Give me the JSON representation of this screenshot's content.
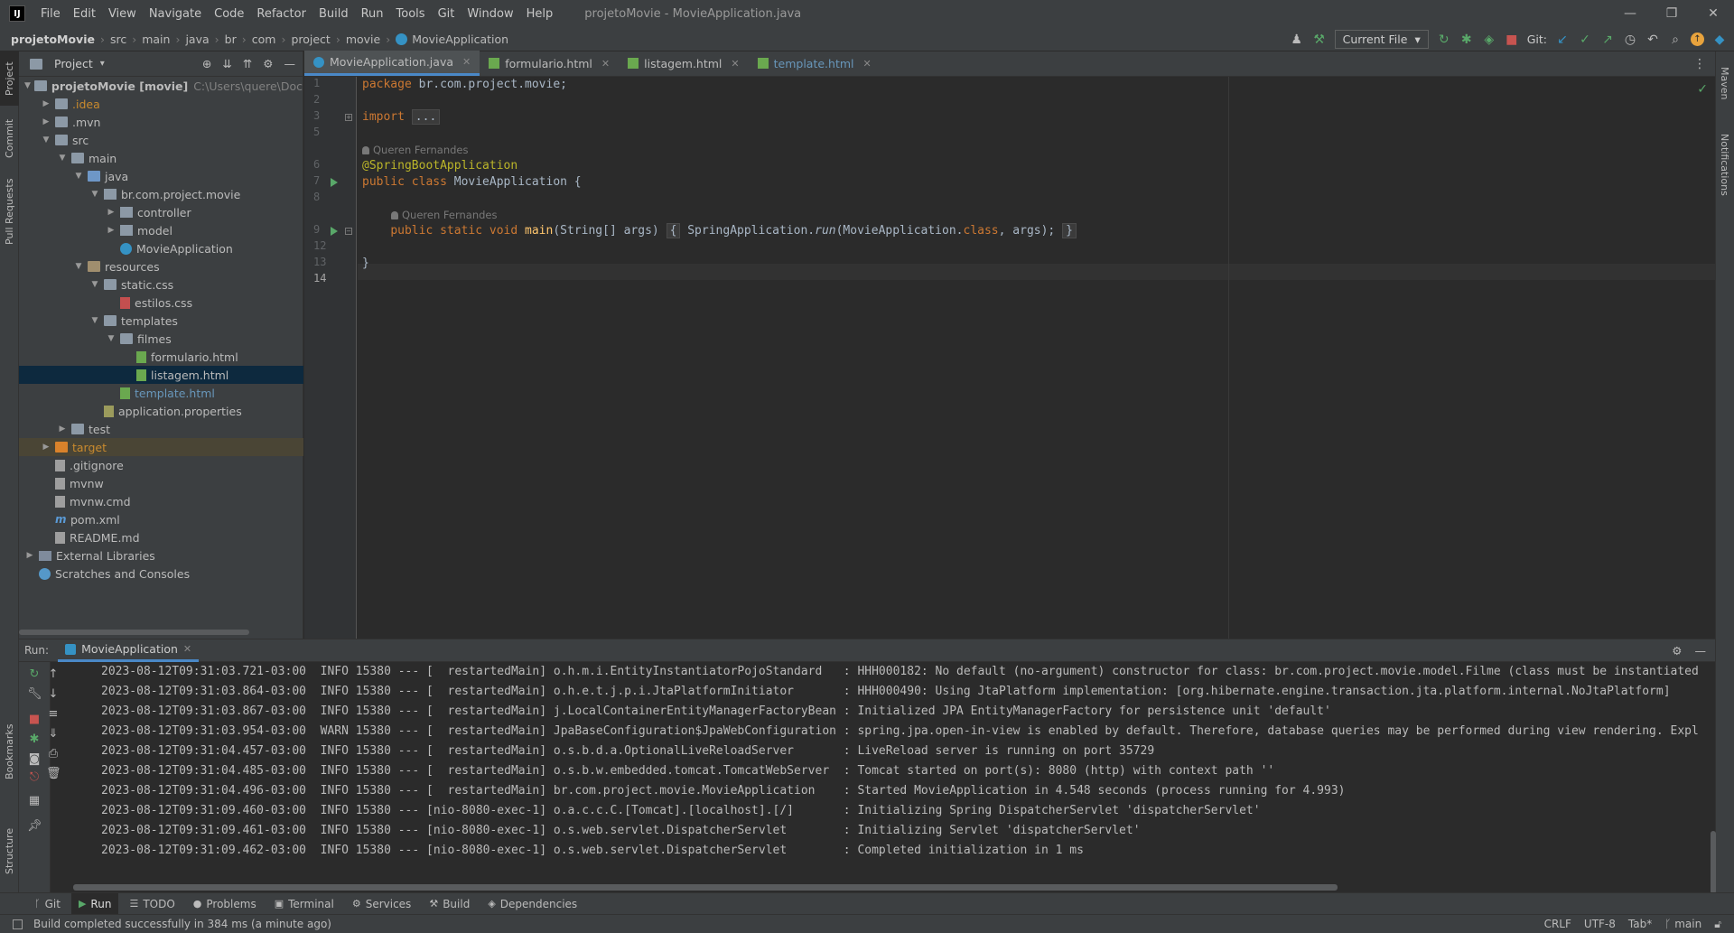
{
  "app": {
    "logo": "IJ",
    "menu": [
      "File",
      "Edit",
      "View",
      "Navigate",
      "Code",
      "Refactor",
      "Build",
      "Run",
      "Tools",
      "Git",
      "Window",
      "Help"
    ],
    "window_title": "projetoMovie - MovieApplication.java",
    "window_controls": {
      "minimize": "—",
      "restore": "❐",
      "close": "✕"
    }
  },
  "navbar": {
    "breadcrumb": [
      "projetoMovie",
      "src",
      "main",
      "java",
      "br",
      "com",
      "project",
      "movie",
      "MovieApplication"
    ],
    "run_config": "Current File",
    "git_label": "Git:"
  },
  "left_strip": {
    "tabs": [
      "Project",
      "Commit",
      "Pull Requests",
      "Bookmarks",
      "Structure"
    ]
  },
  "right_strip": {
    "tabs": [
      "Maven",
      "Notifications"
    ]
  },
  "project_panel": {
    "title": "Project",
    "root_path": "C:\\Users\\quere\\Documents\\",
    "tree": [
      {
        "label": "projetoMovie [movie]",
        "depth": 0,
        "arrow": "open",
        "icon": "folder"
      },
      {
        "label": ".idea",
        "depth": 1,
        "arrow": "closed",
        "icon": "folder",
        "color": "orange"
      },
      {
        "label": ".mvn",
        "depth": 1,
        "arrow": "closed",
        "icon": "folder"
      },
      {
        "label": "src",
        "depth": 1,
        "arrow": "open",
        "icon": "folder"
      },
      {
        "label": "main",
        "depth": 2,
        "arrow": "open",
        "icon": "folder"
      },
      {
        "label": "java",
        "depth": 3,
        "arrow": "open",
        "icon": "folder-blue"
      },
      {
        "label": "br.com.project.movie",
        "depth": 4,
        "arrow": "open",
        "icon": "package"
      },
      {
        "label": "controller",
        "depth": 5,
        "arrow": "closed",
        "icon": "package"
      },
      {
        "label": "model",
        "depth": 5,
        "arrow": "closed",
        "icon": "package"
      },
      {
        "label": "MovieApplication",
        "depth": 5,
        "arrow": "none",
        "icon": "java"
      },
      {
        "label": "resources",
        "depth": 3,
        "arrow": "open",
        "icon": "folder-res"
      },
      {
        "label": "static.css",
        "depth": 4,
        "arrow": "open",
        "icon": "folder"
      },
      {
        "label": "estilos.css",
        "depth": 5,
        "arrow": "none",
        "icon": "css"
      },
      {
        "label": "templates",
        "depth": 4,
        "arrow": "open",
        "icon": "folder"
      },
      {
        "label": "filmes",
        "depth": 5,
        "arrow": "open",
        "icon": "folder"
      },
      {
        "label": "formulario.html",
        "depth": 6,
        "arrow": "none",
        "icon": "html"
      },
      {
        "label": "listagem.html",
        "depth": 6,
        "arrow": "none",
        "icon": "html",
        "selected": true
      },
      {
        "label": "template.html",
        "depth": 5,
        "arrow": "none",
        "icon": "html",
        "color": "blue"
      },
      {
        "label": "application.properties",
        "depth": 4,
        "arrow": "none",
        "icon": "props"
      },
      {
        "label": "test",
        "depth": 2,
        "arrow": "closed",
        "icon": "folder"
      },
      {
        "label": "target",
        "depth": 1,
        "arrow": "closed",
        "icon": "folder-orange",
        "color": "orange",
        "excluded": true
      },
      {
        "label": ".gitignore",
        "depth": 1,
        "arrow": "none",
        "icon": "file"
      },
      {
        "label": "mvnw",
        "depth": 1,
        "arrow": "none",
        "icon": "file"
      },
      {
        "label": "mvnw.cmd",
        "depth": 1,
        "arrow": "none",
        "icon": "file"
      },
      {
        "label": "pom.xml",
        "depth": 1,
        "arrow": "none",
        "icon": "maven"
      },
      {
        "label": "README.md",
        "depth": 1,
        "arrow": "none",
        "icon": "file"
      },
      {
        "label": "External Libraries",
        "depth": 0,
        "arrow": "closed",
        "icon": "libs"
      },
      {
        "label": "Scratches and Consoles",
        "depth": 0,
        "arrow": "none",
        "icon": "scratch"
      }
    ]
  },
  "editor": {
    "tabs": [
      {
        "label": "MovieApplication.java",
        "icon": "java",
        "active": true
      },
      {
        "label": "formulario.html",
        "icon": "html"
      },
      {
        "label": "listagem.html",
        "icon": "html"
      },
      {
        "label": "template.html",
        "icon": "html",
        "color": "blue"
      }
    ],
    "line_numbers": [
      "1",
      "2",
      "3",
      "5",
      "6",
      "7",
      "8",
      "9",
      "12",
      "13",
      "14"
    ],
    "author": "Queren Fernandes",
    "code": {
      "l1_kw": "package",
      "l1_rest": " br.com.project.movie;",
      "l3_kw": "import",
      "l3_fold": "...",
      "l6_ann": "@SpringBootApplication",
      "l7_kw": "public class",
      "l7_rest": " MovieApplication {",
      "l9_kw": "public static void",
      "l9_fn": "main",
      "l9_params": "(String[] args)",
      "l9_open": "{",
      "l9_body_a": "SpringApplication.",
      "l9_body_run": "run",
      "l9_body_b": "(MovieApplication.",
      "l9_body_class": "class",
      "l9_body_c": ", args);",
      "l9_close": "}",
      "l13": "}"
    }
  },
  "run_panel": {
    "label": "Run:",
    "tab": "MovieApplication",
    "console": [
      "2023-08-12T09:31:03.721-03:00  INFO 15380 --- [  restartedMain] o.h.m.i.EntityInstantiatorPojoStandard   : HHH000182: No default (no-argument) constructor for class: br.com.project.movie.model.Filme (class must be instantiated",
      "2023-08-12T09:31:03.864-03:00  INFO 15380 --- [  restartedMain] o.h.e.t.j.p.i.JtaPlatformInitiator       : HHH000490: Using JtaPlatform implementation: [org.hibernate.engine.transaction.jta.platform.internal.NoJtaPlatform]",
      "2023-08-12T09:31:03.867-03:00  INFO 15380 --- [  restartedMain] j.LocalContainerEntityManagerFactoryBean : Initialized JPA EntityManagerFactory for persistence unit 'default'",
      "2023-08-12T09:31:03.954-03:00  WARN 15380 --- [  restartedMain] JpaBaseConfiguration$JpaWebConfiguration : spring.jpa.open-in-view is enabled by default. Therefore, database queries may be performed during view rendering. Expl",
      "2023-08-12T09:31:04.457-03:00  INFO 15380 --- [  restartedMain] o.s.b.d.a.OptionalLiveReloadServer       : LiveReload server is running on port 35729",
      "2023-08-12T09:31:04.485-03:00  INFO 15380 --- [  restartedMain] o.s.b.w.embedded.tomcat.TomcatWebServer  : Tomcat started on port(s): 8080 (http) with context path ''",
      "2023-08-12T09:31:04.496-03:00  INFO 15380 --- [  restartedMain] br.com.project.movie.MovieApplication    : Started MovieApplication in 4.548 seconds (process running for 4.993)",
      "2023-08-12T09:31:09.460-03:00  INFO 15380 --- [nio-8080-exec-1] o.a.c.c.C.[Tomcat].[localhost].[/]       : Initializing Spring DispatcherServlet 'dispatcherServlet'",
      "2023-08-12T09:31:09.461-03:00  INFO 15380 --- [nio-8080-exec-1] o.s.web.servlet.DispatcherServlet        : Initializing Servlet 'dispatcherServlet'",
      "2023-08-12T09:31:09.462-03:00  INFO 15380 --- [nio-8080-exec-1] o.s.web.servlet.DispatcherServlet        : Completed initialization in 1 ms"
    ]
  },
  "bottom_tools": [
    {
      "label": "Git",
      "icon": "git-icon",
      "glyph": "ᚴ"
    },
    {
      "label": "Run",
      "icon": "run-icon",
      "glyph": "▶",
      "active": true
    },
    {
      "label": "TODO",
      "icon": "todo-icon",
      "glyph": "☰"
    },
    {
      "label": "Problems",
      "icon": "problems-icon",
      "glyph": "●"
    },
    {
      "label": "Terminal",
      "icon": "terminal-icon",
      "glyph": "▣"
    },
    {
      "label": "Services",
      "icon": "services-icon",
      "glyph": "⚙"
    },
    {
      "label": "Build",
      "icon": "build-icon",
      "glyph": "⚒"
    },
    {
      "label": "Dependencies",
      "icon": "dependencies-icon",
      "glyph": "◈"
    }
  ],
  "statusbar": {
    "message": "Build completed successfully in 384 ms (a minute ago)",
    "line_sep": "CRLF",
    "encoding": "UTF-8",
    "indent": "Tab*",
    "branch": "main"
  },
  "colors": {
    "accent": "#4a88c7",
    "run_green": "#59a869",
    "stop_red": "#c75450",
    "selection": "#0d293e"
  }
}
